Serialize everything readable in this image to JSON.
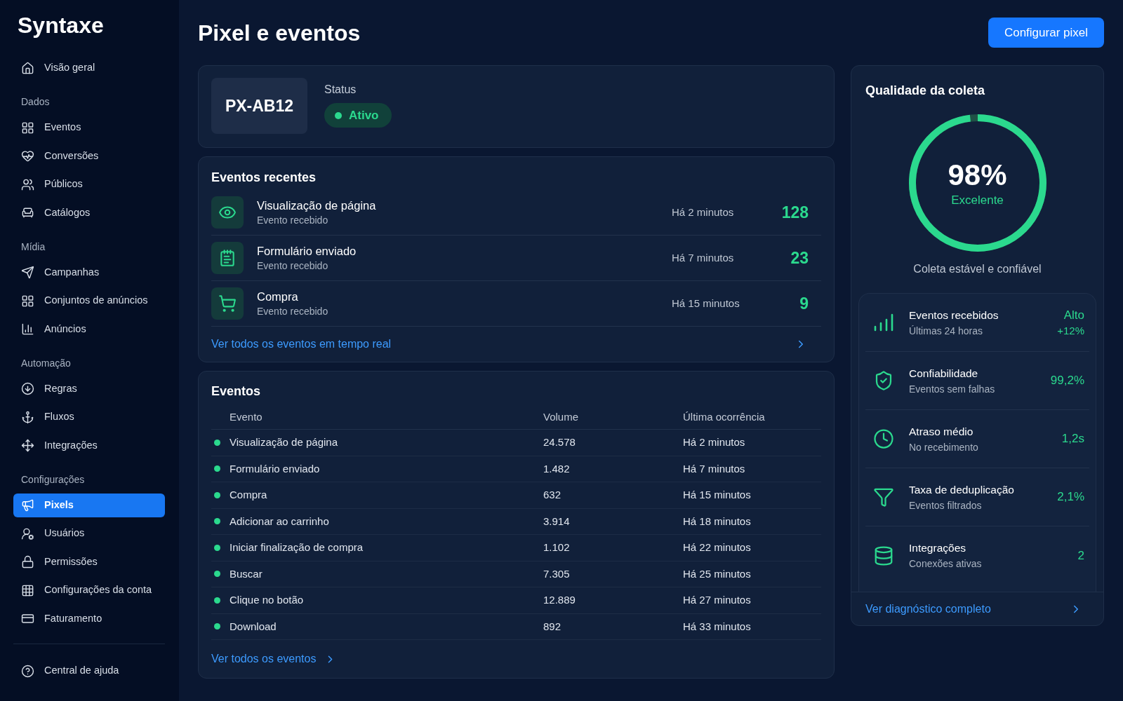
{
  "sidebar": {
    "logo": "Syntaxe",
    "top_items": [
      {
        "label": "Visão geral",
        "selected": false
      }
    ],
    "sections": [
      {
        "heading": "Dados",
        "items": [
          {
            "label": "Eventos",
            "selected": false
          },
          {
            "label": "Conversões",
            "selected": false
          },
          {
            "label": "Públicos",
            "selected": false
          },
          {
            "label": "Catálogos",
            "selected": false
          }
        ]
      },
      {
        "heading": "Mídia",
        "items": [
          {
            "label": "Campanhas",
            "selected": false
          },
          {
            "label": "Conjuntos de anúncios",
            "selected": false
          },
          {
            "label": "Anúncios",
            "selected": false
          }
        ]
      },
      {
        "heading": "Automação",
        "items": [
          {
            "label": "Regras",
            "selected": false
          },
          {
            "label": "Fluxos",
            "selected": false
          },
          {
            "label": "Integrações",
            "selected": false
          }
        ]
      },
      {
        "heading": "Configurações",
        "items": [
          {
            "label": "Pixels",
            "selected": true
          },
          {
            "label": "Usuários",
            "selected": false
          },
          {
            "label": "Permissões",
            "selected": false
          },
          {
            "label": "Configurações da conta",
            "selected": false
          },
          {
            "label": "Faturamento",
            "selected": false
          }
        ]
      }
    ],
    "bottom_items": [
      {
        "label": "Central de ajuda",
        "selected": false
      }
    ]
  },
  "header": {
    "title": "Pixel e eventos",
    "button": "Configurar pixel"
  },
  "pixel": {
    "id": "PX-AB12",
    "status_label": "Status",
    "status": "Ativo"
  },
  "recent_events": {
    "title": "Eventos recentes",
    "items": [
      {
        "name": "Visualização de página",
        "subtitle": "Evento recebido",
        "time": "Há 2 minutos",
        "count": "128"
      },
      {
        "name": "Formulário enviado",
        "subtitle": "Evento recebido",
        "time": "Há 7 minutos",
        "count": "23"
      },
      {
        "name": "Compra",
        "subtitle": "Evento recebido",
        "time": "Há 15 minutos",
        "count": "9"
      }
    ],
    "link": "Ver todos os eventos em tempo real"
  },
  "events_table": {
    "title": "Eventos",
    "columns": [
      "Evento",
      "Volume",
      "Última ocorrência"
    ],
    "rows": [
      [
        "Visualização de página",
        "24.578",
        "Há 2 minutos"
      ],
      [
        "Formulário enviado",
        "1.482",
        "Há 7 minutos"
      ],
      [
        "Compra",
        "632",
        "Há 15 minutos"
      ],
      [
        "Adicionar ao carrinho",
        "3.914",
        "Há 18 minutos"
      ],
      [
        "Iniciar finalização de compra",
        "1.102",
        "Há 22 minutos"
      ],
      [
        "Buscar",
        "7.305",
        "Há 25 minutos"
      ],
      [
        "Clique no botão",
        "12.889",
        "Há 27 minutos"
      ],
      [
        "Download",
        "892",
        "Há 33 minutos"
      ]
    ],
    "link": "Ver todos os eventos"
  },
  "quality": {
    "title": "Qualidade da coleta",
    "level": 0.98,
    "reading": "98%",
    "rating": "Excelente",
    "caption": "Coleta estável e confiável",
    "metrics": [
      {
        "title": "Eventos recebidos",
        "subtitle": "Últimas 24 horas",
        "value": "Alto",
        "change": "+12%"
      },
      {
        "title": "Confiabilidade",
        "subtitle": "Eventos sem falhas",
        "value": "99,2%"
      },
      {
        "title": "Atraso médio",
        "subtitle": "No recebimento",
        "value": "1,2s"
      },
      {
        "title": "Taxa de deduplicação",
        "subtitle": "Eventos filtrados",
        "value": "2,1%"
      },
      {
        "title": "Integrações",
        "subtitle": "Conexões ativas",
        "value": "2"
      }
    ],
    "link": "Ver diagnóstico completo"
  }
}
